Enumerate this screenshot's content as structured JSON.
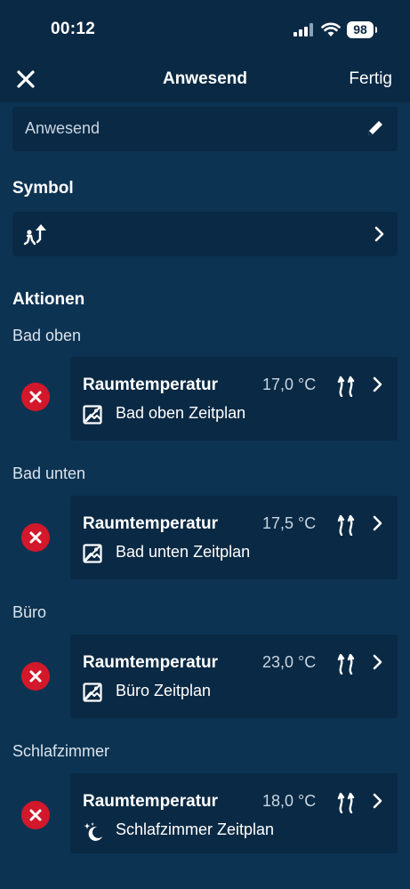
{
  "status_bar": {
    "time": "00:12",
    "battery": "98"
  },
  "nav": {
    "title": "Anwesend",
    "done_label": "Fertig"
  },
  "name_field": {
    "value": "Anwesend"
  },
  "symbol_section": {
    "title": "Symbol",
    "icon": "person-arriving-home-icon"
  },
  "actions_section": {
    "title": "Aktionen",
    "groups": [
      {
        "room": "Bad oben",
        "action": "Raumtemperatur",
        "value": "17,0 °C",
        "schedule": "Bad oben Zeitplan",
        "schedule_icon": "schedule-image-icon"
      },
      {
        "room": "Bad unten",
        "action": "Raumtemperatur",
        "value": "17,5 °C",
        "schedule": "Bad unten Zeitplan",
        "schedule_icon": "schedule-image-icon"
      },
      {
        "room": "Büro",
        "action": "Raumtemperatur",
        "value": "23,0 °C",
        "schedule": "Büro Zeitplan",
        "schedule_icon": "schedule-image-icon"
      },
      {
        "room": "Schlafzimmer",
        "action": "Raumtemperatur",
        "value": "18,0 °C",
        "schedule": "Schlafzimmer Zeitplan",
        "schedule_icon": "moon-stars-icon"
      }
    ]
  },
  "colors": {
    "background": "#0d3352",
    "header": "#0a2944",
    "card": "#0a2944",
    "remove": "#d2182a"
  }
}
